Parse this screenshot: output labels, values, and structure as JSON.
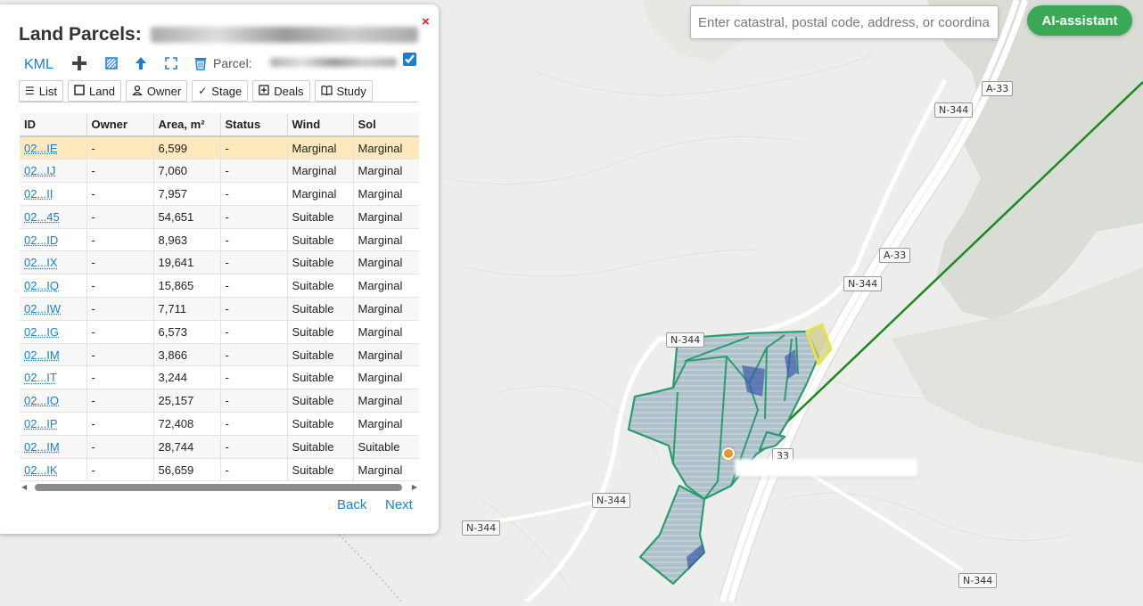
{
  "search": {
    "placeholder": "Enter catastral, postal code, address, or coordina"
  },
  "ai_button": {
    "label": "AI-assistant"
  },
  "panel": {
    "title": "Land Parcels:",
    "close_label": "×",
    "toolbar": {
      "kml_label": "KML",
      "add_icon": "plus-icon",
      "layer_icon": "hatch-icon",
      "upload_icon": "upload-arrow-icon",
      "fullscreen_icon": "expand-icon",
      "delete_icon": "trash-icon",
      "parcel_label": "Parcel:",
      "parcel_checked": true
    },
    "tabs": [
      {
        "label": "List",
        "icon": "list-icon"
      },
      {
        "label": "Land",
        "icon": "square-icon"
      },
      {
        "label": "Owner",
        "icon": "person-icon"
      },
      {
        "label": "Stage",
        "icon": "check-icon"
      },
      {
        "label": "Deals",
        "icon": "plus-square-icon"
      },
      {
        "label": "Study",
        "icon": "book-icon"
      }
    ],
    "table": {
      "columns": [
        "ID",
        "Owner",
        "Area, m²",
        "Status",
        "Wind",
        "Sol"
      ],
      "rows": [
        [
          "02...IE",
          "-",
          "6,599",
          "-",
          "Marginal",
          "Marginal"
        ],
        [
          "02...IJ",
          "-",
          "7,060",
          "-",
          "Marginal",
          "Marginal"
        ],
        [
          "02...II",
          "-",
          "7,957",
          "-",
          "Marginal",
          "Marginal"
        ],
        [
          "02...45",
          "-",
          "54,651",
          "-",
          "Suitable",
          "Marginal"
        ],
        [
          "02...ID",
          "-",
          "8,963",
          "-",
          "Suitable",
          "Marginal"
        ],
        [
          "02...IX",
          "-",
          "19,641",
          "-",
          "Suitable",
          "Marginal"
        ],
        [
          "02...IQ",
          "-",
          "15,865",
          "-",
          "Suitable",
          "Marginal"
        ],
        [
          "02...IW",
          "-",
          "7,711",
          "-",
          "Suitable",
          "Marginal"
        ],
        [
          "02...IG",
          "-",
          "6,573",
          "-",
          "Suitable",
          "Marginal"
        ],
        [
          "02...IM",
          "-",
          "3,866",
          "-",
          "Suitable",
          "Marginal"
        ],
        [
          "02...IT",
          "-",
          "3,244",
          "-",
          "Suitable",
          "Marginal"
        ],
        [
          "02...IO",
          "-",
          "25,157",
          "-",
          "Suitable",
          "Marginal"
        ],
        [
          "02...IP",
          "-",
          "72,408",
          "-",
          "Suitable",
          "Marginal"
        ],
        [
          "02...IM",
          "-",
          "28,744",
          "-",
          "Suitable",
          "Suitable"
        ],
        [
          "02...IK",
          "-",
          "56,659",
          "-",
          "Suitable",
          "Marginal"
        ]
      ],
      "selected_row": 0
    },
    "pager": {
      "back_label": "Back",
      "next_label": "Next"
    }
  },
  "map": {
    "road_labels": [
      "A-33",
      "N-344",
      "A-33",
      "N-344",
      "N-344",
      "33",
      "N-344",
      "N-344",
      "N-344"
    ],
    "colors": {
      "parcel_fill": "#9fb6c2",
      "parcel_stroke": "#2a9c6e",
      "selected_parcel": "#e8e24a",
      "power_line": "#1b8a1b",
      "forest": "#d6dcd4",
      "marker": "#f0922c"
    }
  }
}
